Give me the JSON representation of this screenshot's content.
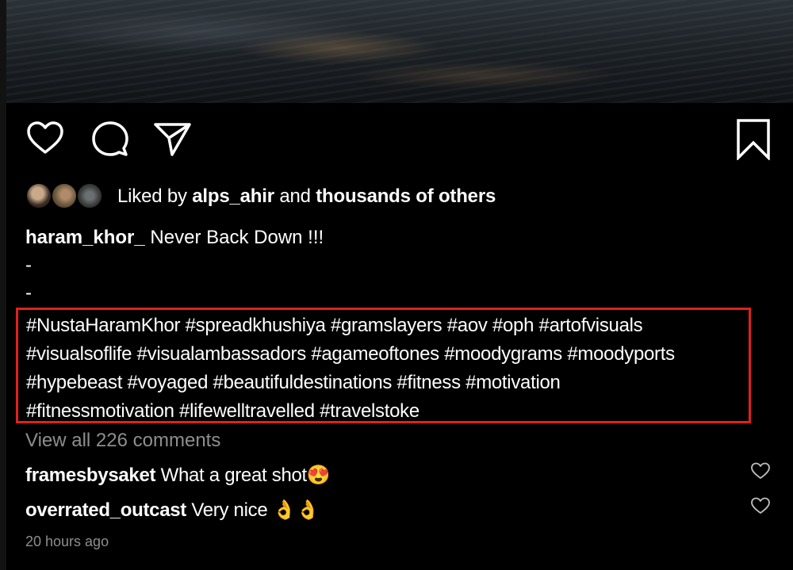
{
  "post": {
    "image_alt": "dark water night photo",
    "likes": {
      "prefix": "Liked by",
      "user": "alps_ahir",
      "conjunction": "and",
      "others": "thousands of others"
    },
    "caption": {
      "username": "haram_khor_",
      "text": "Never Back Down !!!",
      "lines": [
        "-",
        "-"
      ]
    },
    "hashtags": [
      "#NustaHaramKhor #spreadkhushiya #gramslayers #aov #oph #artofvisuals",
      "#visualsoflife #visualambassadors #agameoftones #moodygrams #moodyports",
      "#hypebeast #voyaged #beautifuldestinations #fitness #motivation",
      "#fitnessmotivation #lifewelltravelled #travelstoke"
    ],
    "view_all_comments": "View all 226 comments",
    "comments": [
      {
        "username": "framesbysaket",
        "text": "What a great shot😍"
      },
      {
        "username": "overrated_outcast",
        "text": "Very nice 👌👌"
      }
    ],
    "timestamp": "20 hours ago"
  },
  "icons": {
    "like": "heart-icon",
    "comment": "comment-bubble-icon",
    "share": "paper-plane-icon",
    "save": "bookmark-icon"
  },
  "colors": {
    "background": "#000000",
    "highlight_box": "#e02020",
    "muted_text": "#8e8e8e"
  }
}
